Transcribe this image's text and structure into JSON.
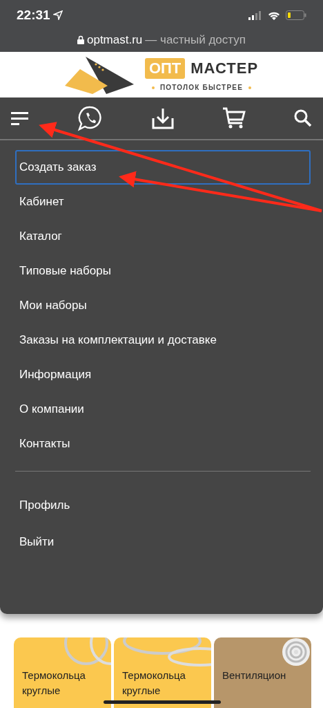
{
  "status_bar": {
    "time": "22:31",
    "url_host": "optmast.ru",
    "url_note": "— частный доступ"
  },
  "logo": {
    "badge": "ОПТ",
    "name": "МАСТЕР",
    "tagline": "ПОТОЛОК БЫСТРЕЕ"
  },
  "menu": {
    "items": [
      {
        "label": "Создать заказ",
        "selected": true
      },
      {
        "label": "Кабинет",
        "selected": false
      },
      {
        "label": "Каталог",
        "selected": false
      },
      {
        "label": "Типовые наборы",
        "selected": false
      },
      {
        "label": "Мои наборы",
        "selected": false
      },
      {
        "label": "Заказы на комплектации и доставке",
        "selected": false
      },
      {
        "label": "Информация",
        "selected": false
      },
      {
        "label": "О компании",
        "selected": false
      },
      {
        "label": "Контакты",
        "selected": false
      }
    ],
    "account_items": [
      {
        "label": "Профиль"
      },
      {
        "label": "Выйти"
      }
    ]
  },
  "cards": [
    {
      "title": "Термокольца\nкруглые",
      "color": "#fbc84f"
    },
    {
      "title": "Термокольца\nкруглые",
      "color": "#fbc84f"
    },
    {
      "title": "Вентиляцион",
      "color": "#b7966a"
    }
  ]
}
